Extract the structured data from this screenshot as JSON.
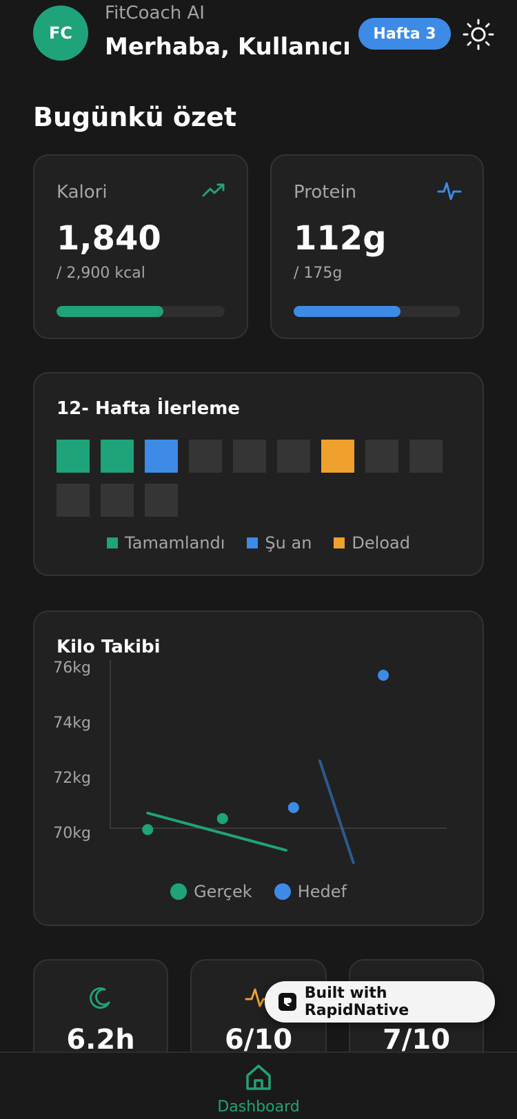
{
  "header": {
    "avatar_initials": "FC",
    "app_name": "FitCoach AI",
    "greeting": "Merhaba, Kullanıcı",
    "week_badge": "Hafta 3",
    "theme_icon": "sun-icon"
  },
  "summary": {
    "title": "Bugünkü özet",
    "calories": {
      "label": "Kalori",
      "value": "1,840",
      "target": "/ 2,900 kcal",
      "progress": 0.634,
      "icon": "trending-up-icon",
      "color": "#1fa37a"
    },
    "protein": {
      "label": "Protein",
      "value": "112g",
      "target": "/ 175g",
      "progress": 0.64,
      "icon": "activity-icon",
      "color": "#3d8be6"
    }
  },
  "weeks": {
    "title": "12- Hafta İlerleme",
    "statuses": [
      "done",
      "done",
      "current",
      "pending",
      "pending",
      "pending",
      "deload",
      "pending",
      "pending",
      "pending",
      "pending",
      "pending"
    ],
    "colors": {
      "done": "#1fa37a",
      "current": "#3d8be6",
      "deload": "#f0a02c",
      "pending": "#353535"
    },
    "legend": [
      {
        "label": "Tamamlandı",
        "color": "#1fa37a"
      },
      {
        "label": "Şu an",
        "color": "#3d8be6"
      },
      {
        "label": "Deload",
        "color": "#f0a02c"
      }
    ]
  },
  "weight_chart": {
    "title": "Kilo Takibi",
    "legend": [
      {
        "label": "Gerçek",
        "color": "#1fa37a"
      },
      {
        "label": "Hedef",
        "color": "#3d8be6"
      }
    ]
  },
  "chart_data": {
    "type": "scatter",
    "title": "Kilo Takibi",
    "y_ticks": [
      "76kg",
      "74kg",
      "72kg",
      "70kg"
    ],
    "ylim": [
      69,
      76.5
    ],
    "xlim": [
      0,
      4.7
    ],
    "grid": false,
    "legend_position": "bottom",
    "series": [
      {
        "name": "Gerçek",
        "color": "#1fa37a",
        "points": [
          {
            "x": 0.5,
            "y": 70.1
          },
          {
            "x": 1.5,
            "y": 70.5
          }
        ],
        "trend": [
          {
            "x": 0.5,
            "y": 70.7
          },
          {
            "x": 2.35,
            "y": 69.35
          }
        ]
      },
      {
        "name": "Hedef",
        "color": "#3d8be6",
        "points": [
          {
            "x": 2.45,
            "y": 70.9
          },
          {
            "x": 3.65,
            "y": 75.7
          }
        ],
        "trend": [
          {
            "x": 2.8,
            "y": 72.6
          },
          {
            "x": 3.25,
            "y": 68.9
          }
        ]
      }
    ]
  },
  "metrics": [
    {
      "value": "6.2h",
      "icon": "moon-icon",
      "color": "#1fa37a"
    },
    {
      "value": "6/10",
      "icon": "pulse-icon",
      "color": "#f0a02c"
    },
    {
      "value": "7/10",
      "icon": "star-icon",
      "color": "#3d8be6"
    }
  ],
  "badge": {
    "label": "Built with RapidNative"
  },
  "nav": {
    "dashboard_label": "Dashboard",
    "icon": "home-icon"
  }
}
